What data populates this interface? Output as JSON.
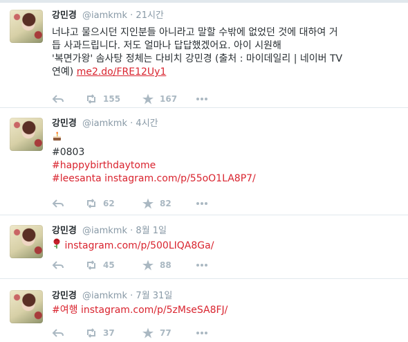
{
  "tweets": [
    {
      "name": "강민경",
      "handle": "@iamkmk",
      "separator": "·",
      "time": "21시간",
      "lines": [
        "너냐고 물으시던 지인분들 아니라고 말할 수밖에 없었던 것에 대하여 거",
        "듭 사과드립니다. 저도 얼마나 답답했겠어요. 아이 시원해",
        "'복면가왕' 솜사탕 정체는 다비치 강민경 (출처 : 마이데일리 | 네이버 TV",
        "연예) "
      ],
      "link": "me2.do/FRE12Uy1",
      "retweets": "155",
      "likes": "167"
    },
    {
      "name": "강민경",
      "handle": "@iamkmk",
      "separator": "·",
      "time": "4시간",
      "emoji": "cake-emoji",
      "line2": "#0803",
      "line3": "#happybirthdaytome",
      "line4_hashtag": "#leesanta",
      "line4_link": "instagram.com/p/55oO1LA8P7/",
      "retweets": "62",
      "likes": "82"
    },
    {
      "name": "강민경",
      "handle": "@iamkmk",
      "separator": "·",
      "time": "8월 1일",
      "emoji": "rose-emoji",
      "link": "instagram.com/p/500LIQA8Ga/",
      "retweets": "45",
      "likes": "88"
    },
    {
      "name": "강민경",
      "handle": "@iamkmk",
      "separator": "·",
      "time": "7월 31일",
      "hashtag": "#여행",
      "link": "instagram.com/p/5zMseSA8FJ/",
      "retweets": "37",
      "likes": "77"
    }
  ],
  "colors": {
    "accent": "#d9232e",
    "muted": "#8899a6",
    "icon": "#aab8c2",
    "divider": "#e1e8ed"
  },
  "icons": [
    "reply-icon",
    "retweet-icon",
    "like-icon",
    "more-icon"
  ]
}
